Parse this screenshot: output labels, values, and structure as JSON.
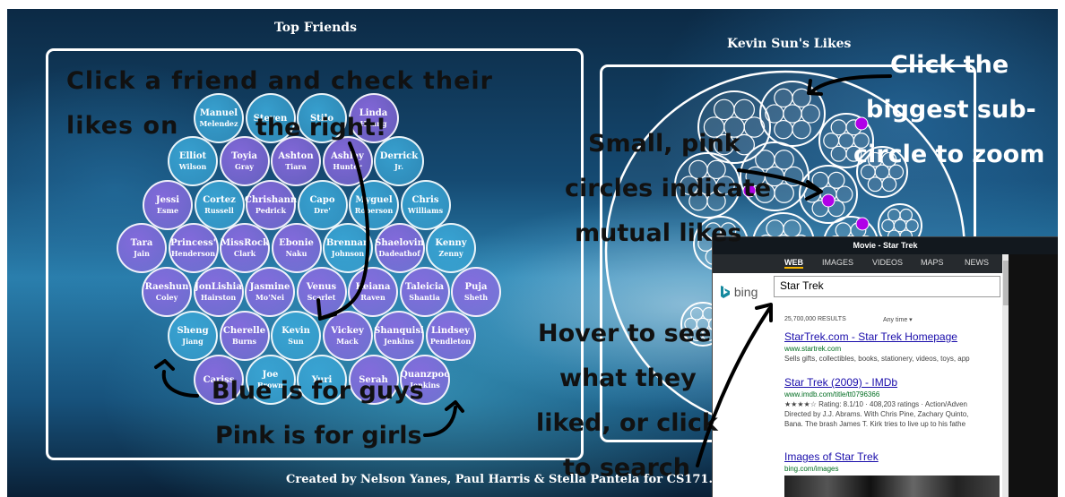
{
  "left_panel": {
    "title": "Top Friends"
  },
  "right_panel": {
    "title": "Kevin Sun's Likes"
  },
  "friends": [
    {
      "first": "Manuel",
      "last": "Melendez",
      "gender": "male"
    },
    {
      "first": "Steven",
      "last": "",
      "gender": "male"
    },
    {
      "first": "Stilo",
      "last": "",
      "gender": "male"
    },
    {
      "first": "Linda",
      "last": "Huang",
      "gender": "female"
    },
    {
      "first": "Elliot",
      "last": "Wilson",
      "gender": "male"
    },
    {
      "first": "Toyia",
      "last": "Gray",
      "gender": "female"
    },
    {
      "first": "Ashton",
      "last": "Tiara",
      "gender": "female"
    },
    {
      "first": "Ashley",
      "last": "Hunter",
      "gender": "female"
    },
    {
      "first": "Derrick",
      "last": "Jr.",
      "gender": "male"
    },
    {
      "first": "Jessi",
      "last": "Esme",
      "gender": "female"
    },
    {
      "first": "Cortez",
      "last": "Russell",
      "gender": "male"
    },
    {
      "first": "Chrishann",
      "last": "Pedrick",
      "gender": "female"
    },
    {
      "first": "Capo",
      "last": "Dre'",
      "gender": "male"
    },
    {
      "first": "Myguel",
      "last": "Roberson",
      "gender": "male"
    },
    {
      "first": "Chris",
      "last": "Williams",
      "gender": "male"
    },
    {
      "first": "Tara",
      "last": "Jain",
      "gender": "female"
    },
    {
      "first": "Princess'",
      "last": "Henderson",
      "gender": "female"
    },
    {
      "first": "MissRock",
      "last": "Clark",
      "gender": "female"
    },
    {
      "first": "Ebonie",
      "last": "Naku",
      "gender": "female"
    },
    {
      "first": "Brennan",
      "last": "Johnson",
      "gender": "male"
    },
    {
      "first": "Shaelovin",
      "last": "Dadeathof",
      "gender": "female"
    },
    {
      "first": "Kenny",
      "last": "Zenny",
      "gender": "male"
    },
    {
      "first": "Raeshun",
      "last": "Coley",
      "gender": "female"
    },
    {
      "first": "JonLishia",
      "last": "Hairston",
      "gender": "female"
    },
    {
      "first": "Jasmine",
      "last": "Mo'Nei",
      "gender": "female"
    },
    {
      "first": "Venus",
      "last": "Scarlet",
      "gender": "female"
    },
    {
      "first": "Keiana",
      "last": "Raven",
      "gender": "female"
    },
    {
      "first": "Taleicia",
      "last": "Shantia",
      "gender": "female"
    },
    {
      "first": "Puja",
      "last": "Sheth",
      "gender": "female"
    },
    {
      "first": "Sheng",
      "last": "Jiang",
      "gender": "male"
    },
    {
      "first": "Cherelle",
      "last": "Burns",
      "gender": "female"
    },
    {
      "first": "Kevin",
      "last": "Sun",
      "gender": "male"
    },
    {
      "first": "Vickey",
      "last": "Mack",
      "gender": "female"
    },
    {
      "first": "Shanquisi",
      "last": "Jenkins",
      "gender": "female"
    },
    {
      "first": "Lindsey",
      "last": "Pendleton",
      "gender": "female"
    },
    {
      "first": "Cariss",
      "last": "",
      "gender": "female"
    },
    {
      "first": "Joe",
      "last": "Brown",
      "gender": "male"
    },
    {
      "first": "Yuri",
      "last": "",
      "gender": "male"
    },
    {
      "first": "Serah",
      "last": "",
      "gender": "female"
    },
    {
      "first": "Quanzpoo",
      "last": "Jenkins",
      "gender": "female"
    }
  ],
  "annotations": {
    "click_friend_1": "Click a friend and check their likes on",
    "click_friend_2": "the right!",
    "small_pink_1": "Small, pink",
    "small_pink_2": "circles indicate",
    "small_pink_3": "mutual likes",
    "click_biggest_1": "Click the",
    "click_biggest_2": "biggest sub-",
    "click_biggest_3": "circle to zoom",
    "hover_1": "Hover to see",
    "hover_2": "what they",
    "hover_3": "liked, or click",
    "hover_4": "to search",
    "blue_guys": "Blue is for guys",
    "pink_girls": "Pink is for girls"
  },
  "bing": {
    "window_title": "Movie - Star Trek",
    "tabs": [
      "WEB",
      "IMAGES",
      "VIDEOS",
      "MAPS",
      "NEWS"
    ],
    "active_tab": "WEB",
    "logo_text": "bing",
    "query": "Star Trek",
    "result_count": "25,700,000 RESULTS",
    "time_filter": "Any time ▾",
    "results": [
      {
        "title": "StarTrek.com - Star Trek Homepage",
        "url": "www.startrek.com",
        "desc": "Sells gifts, collectibles, books, stationery, videos, toys, app"
      },
      {
        "title": "Star Trek (2009) - IMDb",
        "url": "www.imdb.com/title/tt0796366",
        "desc": "★★★★☆ Rating: 8.1/10 · 408,203 ratings · Action/Adven"
      },
      {
        "title": "Images of Star Trek",
        "url": "bing.com/images",
        "desc": ""
      }
    ],
    "result2_desc2": "Directed by J.J. Abrams. With Chris Pine, Zachary Quinto,",
    "result2_desc3": "Bana. The brash James T. Kirk tries to live up to his fathe"
  },
  "footer": "Created by Nelson Yanes, Paul Harris & Stella Pantela for CS171.",
  "colors": {
    "male": "#3aa6d6",
    "female": "#8a6ae0",
    "mutual": "#b000e8"
  }
}
